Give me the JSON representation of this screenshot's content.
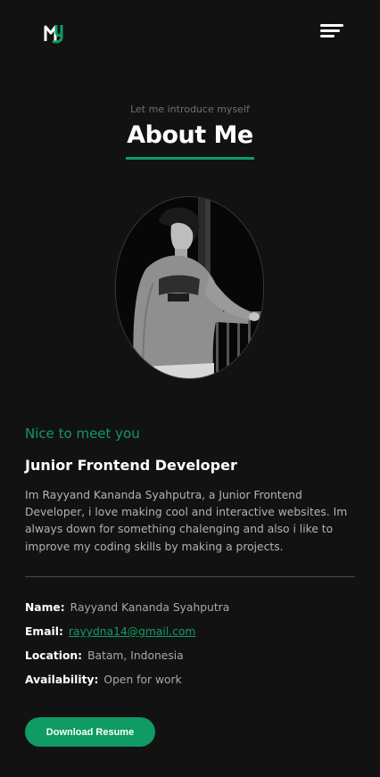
{
  "header": {
    "logo_icon": "my-monogram-logo",
    "menu_icon": "hamburger-menu-icon"
  },
  "section": {
    "eyebrow": "Let me introduce myself",
    "title": "About Me"
  },
  "portrait": {
    "icon": "profile-photo"
  },
  "intro": {
    "greeting": "Nice to meet you",
    "role": "Junior Frontend Developer",
    "bio": "Im Rayyand Kananda Syahputra, a Junior Frontend Developer, i love making cool and interactive websites. Im always down for something chalenging and also i like to improve my coding skills by making a projects."
  },
  "info": {
    "name_label": "Name:",
    "name_value": "Rayyand Kananda Syahputra",
    "email_label": "Email:",
    "email_value": "rayydna14@gmail.com",
    "location_label": "Location:",
    "location_value": "Batam, Indonesia",
    "availability_label": "Availability:",
    "availability_value": "Open for work"
  },
  "actions": {
    "download_label": "Download Resume"
  },
  "colors": {
    "accent": "#0f9b63",
    "background": "#121212",
    "text": "#ffffff",
    "muted": "#b3b3b3"
  }
}
